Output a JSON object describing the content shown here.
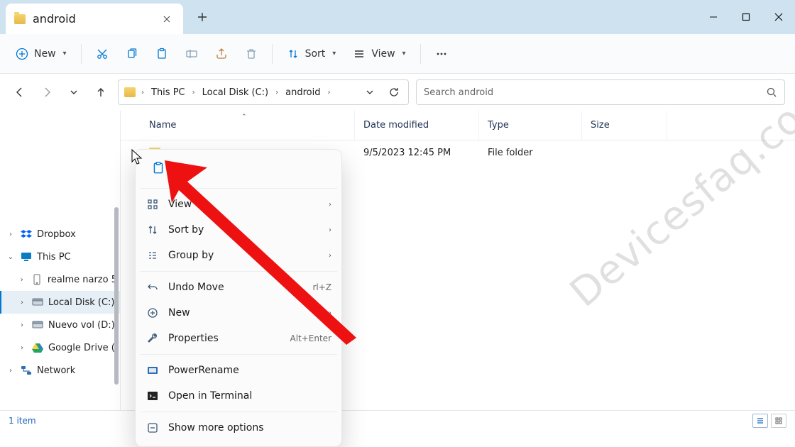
{
  "tab": {
    "title": "android"
  },
  "toolbar": {
    "new": "New",
    "sort": "Sort",
    "view": "View"
  },
  "breadcrumb": [
    "This PC",
    "Local Disk (C:)",
    "android"
  ],
  "search": {
    "placeholder": "Search android"
  },
  "columns": {
    "name": "Name",
    "date": "Date modified",
    "type": "Type",
    "size": "Size"
  },
  "rows": [
    {
      "name": "",
      "date": "9/5/2023 12:45 PM",
      "type": "File folder",
      "size": ""
    }
  ],
  "sidebar": {
    "items": [
      {
        "label": "Dropbox"
      },
      {
        "label": "This PC"
      },
      {
        "label": "realme narzo 5"
      },
      {
        "label": "Local Disk (C:)"
      },
      {
        "label": "Nuevo vol (D:)"
      },
      {
        "label": "Google Drive ("
      },
      {
        "label": "Network"
      }
    ]
  },
  "context_menu": {
    "view": "View",
    "sort_by": "Sort by",
    "group_by": "Group by",
    "undo_move": "Undo Move",
    "undo_move_sc": "rl+Z",
    "new": "New",
    "properties": "Properties",
    "properties_sc": "Alt+Enter",
    "power_rename": "PowerRename",
    "open_terminal": "Open in Terminal",
    "show_more": "Show more options"
  },
  "status": {
    "count": "1 item"
  },
  "watermark": "Devicesfaq.com"
}
